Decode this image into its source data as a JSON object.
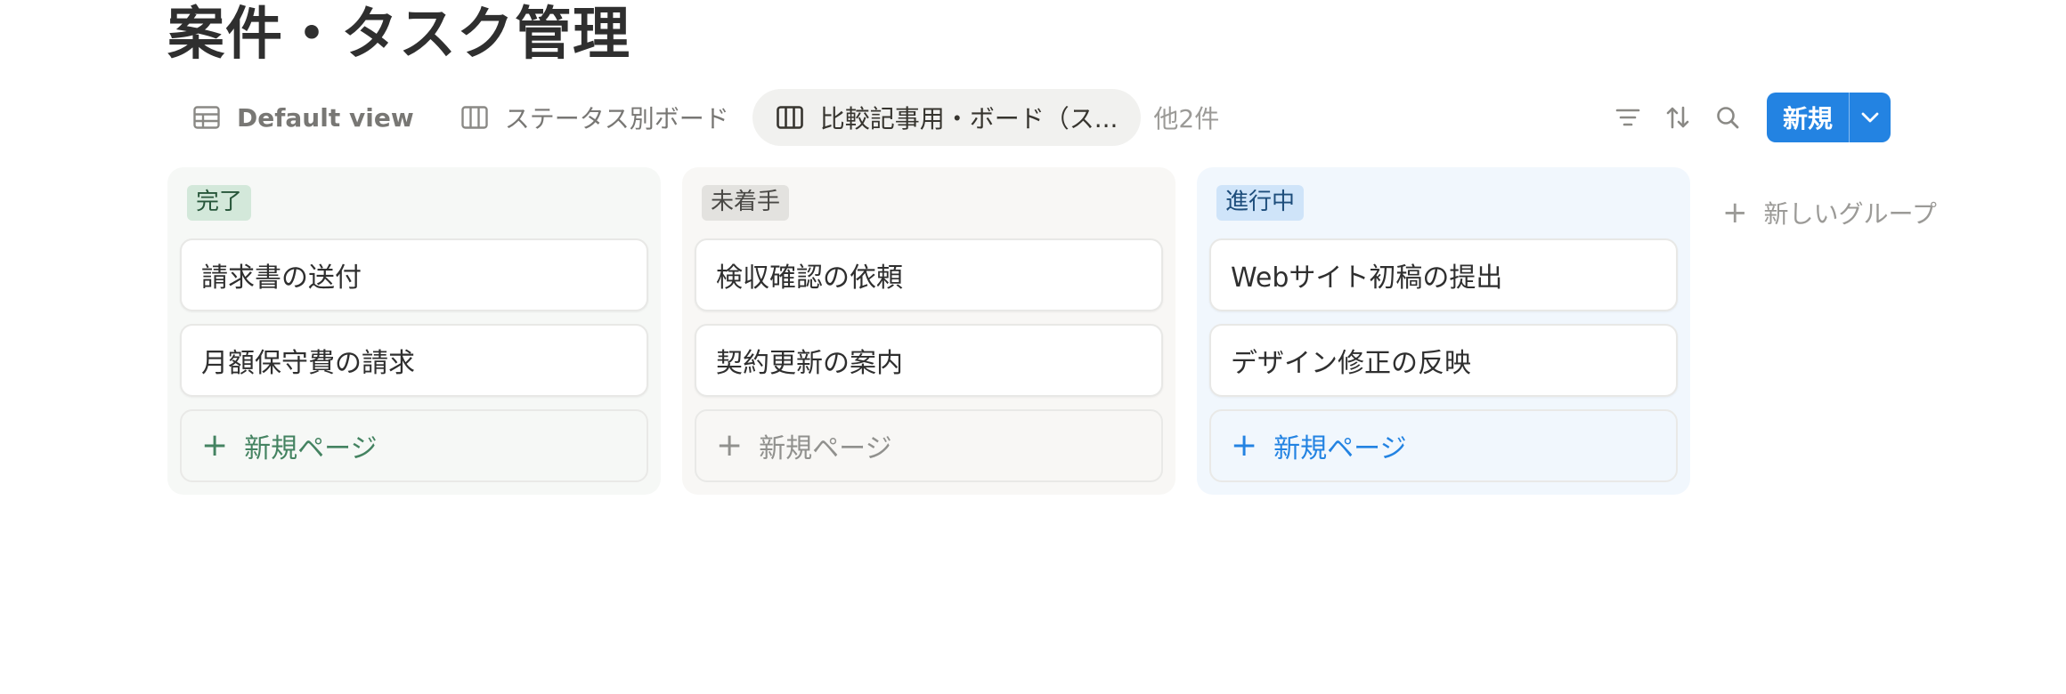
{
  "page_title": "案件・タスク管理",
  "views": [
    {
      "label": "Default view",
      "icon": "table-icon"
    },
    {
      "label": "ステータス別ボード",
      "icon": "board-icon"
    },
    {
      "label": "比較記事用・ボード（ス...",
      "icon": "board-icon",
      "active": true
    }
  ],
  "more_views_label": "他2件",
  "toolbar": {
    "filter_icon": "filter-icon",
    "sort_icon": "sort-icon",
    "search_icon": "search-icon",
    "new_label": "新規",
    "dropdown_icon": "chevron-down-icon"
  },
  "columns": [
    {
      "status": "完了",
      "color": "#448361",
      "cards": [
        "請求書の送付",
        "月額保守費の請求"
      ],
      "add_label": "新規ページ"
    },
    {
      "status": "未着手",
      "color": "#91918e",
      "cards": [
        "検収確認の依頼",
        "契約更新の案内"
      ],
      "add_label": "新規ページ"
    },
    {
      "status": "進行中",
      "color": "#2383e2",
      "cards": [
        "Webサイト初稿の提出",
        "デザイン修正の反映"
      ],
      "add_label": "新規ページ"
    }
  ],
  "new_group_label": "新しいグループ",
  "colors": {
    "accent": "#2383e2",
    "done": "#448361",
    "not_started": "#91918e",
    "in_progress": "#2383e2"
  }
}
